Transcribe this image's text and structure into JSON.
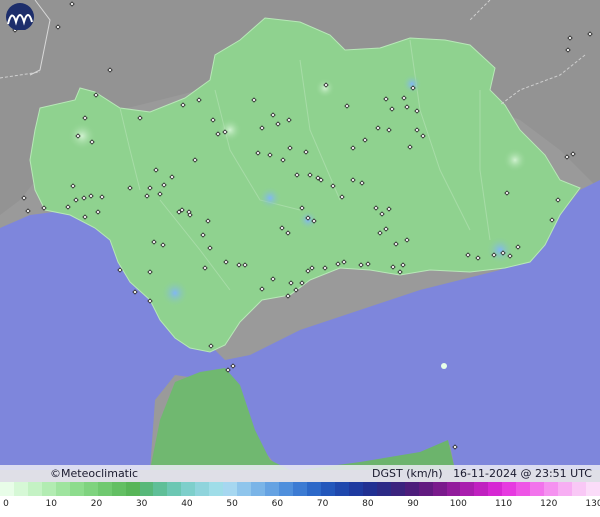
{
  "credit": "©Meteoclimatic",
  "info": {
    "variable": "DGST (km/h)",
    "timestamp": "16-11-2024 @ 23:51 UTC"
  },
  "colors": {
    "sea": "#7e86dc",
    "land_outside": "#9a9a9a",
    "region": "#8fd28f"
  },
  "scale": {
    "unit": "km/h",
    "labels": [
      "0",
      "10",
      "20",
      "30",
      "40",
      "50",
      "60",
      "70",
      "80",
      "90",
      "100",
      "110",
      "120",
      "130"
    ],
    "swatches": [
      "#e8fde8",
      "#d6f8d6",
      "#c4f2c4",
      "#b2ecb2",
      "#9fe49f",
      "#8ddc8d",
      "#7fd37f",
      "#70c970",
      "#63bf63",
      "#58b558",
      "#58b87a",
      "#5fbf98",
      "#6cc7b3",
      "#7ecfcb",
      "#8fd4dc",
      "#9fdde8",
      "#a6d7f0",
      "#8fc5ec",
      "#7ab4e7",
      "#65a2e2",
      "#4f8fdc",
      "#3c7bd3",
      "#2c68c8",
      "#2357bb",
      "#1f48ad",
      "#1e3aa0",
      "#213092",
      "#2c2a86",
      "#3b237e",
      "#4d1d7b",
      "#621a80",
      "#7a1a8c",
      "#921c9c",
      "#a91eae",
      "#c021c0",
      "#d628d3",
      "#e63ae0",
      "#ee55e6",
      "#f274ec",
      "#f592f0",
      "#f7aef3",
      "#f9c8f6",
      "#fbdcf9"
    ]
  }
}
